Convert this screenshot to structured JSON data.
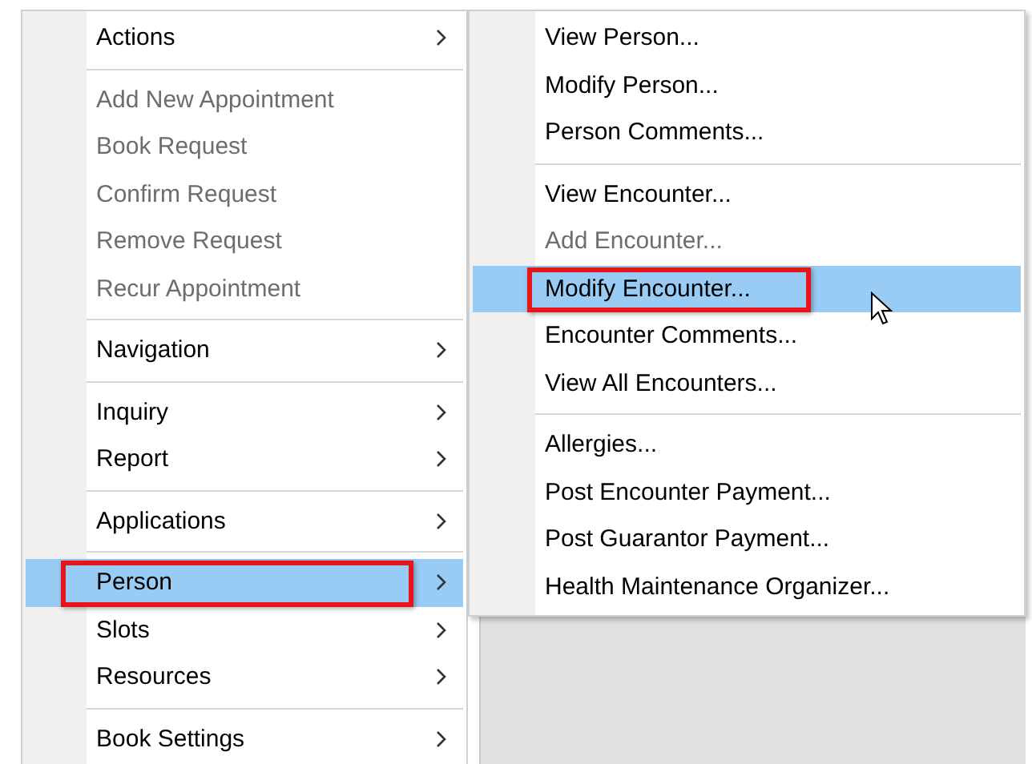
{
  "main_menu": {
    "groups": [
      {
        "items": [
          {
            "label": "Actions",
            "submenu": true,
            "disabled": false,
            "selected": false,
            "outlined": false
          }
        ]
      },
      {
        "items": [
          {
            "label": "Add New Appointment",
            "submenu": false,
            "disabled": true,
            "selected": false,
            "outlined": false
          },
          {
            "label": "Book Request",
            "submenu": false,
            "disabled": true,
            "selected": false,
            "outlined": false
          },
          {
            "label": "Confirm Request",
            "submenu": false,
            "disabled": true,
            "selected": false,
            "outlined": false
          },
          {
            "label": "Remove Request",
            "submenu": false,
            "disabled": true,
            "selected": false,
            "outlined": false
          },
          {
            "label": "Recur Appointment",
            "submenu": false,
            "disabled": true,
            "selected": false,
            "outlined": false
          }
        ]
      },
      {
        "items": [
          {
            "label": "Navigation",
            "submenu": true,
            "disabled": false,
            "selected": false,
            "outlined": false
          }
        ]
      },
      {
        "items": [
          {
            "label": "Inquiry",
            "submenu": true,
            "disabled": false,
            "selected": false,
            "outlined": false
          },
          {
            "label": "Report",
            "submenu": true,
            "disabled": false,
            "selected": false,
            "outlined": false
          }
        ]
      },
      {
        "items": [
          {
            "label": "Applications",
            "submenu": true,
            "disabled": false,
            "selected": false,
            "outlined": false
          }
        ]
      },
      {
        "items": [
          {
            "label": "Person",
            "submenu": true,
            "disabled": false,
            "selected": true,
            "outlined": true
          },
          {
            "label": "Slots",
            "submenu": true,
            "disabled": false,
            "selected": false,
            "outlined": false
          },
          {
            "label": "Resources",
            "submenu": true,
            "disabled": false,
            "selected": false,
            "outlined": false
          }
        ]
      },
      {
        "items": [
          {
            "label": "Book Settings",
            "submenu": true,
            "disabled": false,
            "selected": false,
            "outlined": false
          }
        ]
      }
    ]
  },
  "person_submenu": {
    "groups": [
      {
        "items": [
          {
            "label": "View Person...",
            "submenu": false,
            "disabled": false,
            "selected": false,
            "outlined": false
          },
          {
            "label": "Modify Person...",
            "submenu": false,
            "disabled": false,
            "selected": false,
            "outlined": false
          },
          {
            "label": "Person Comments...",
            "submenu": false,
            "disabled": false,
            "selected": false,
            "outlined": false
          }
        ]
      },
      {
        "items": [
          {
            "label": "View Encounter...",
            "submenu": false,
            "disabled": false,
            "selected": false,
            "outlined": false
          },
          {
            "label": "Add Encounter...",
            "submenu": false,
            "disabled": true,
            "selected": false,
            "outlined": false
          },
          {
            "label": "Modify Encounter...",
            "submenu": false,
            "disabled": false,
            "selected": true,
            "outlined": true
          },
          {
            "label": "Encounter Comments...",
            "submenu": false,
            "disabled": false,
            "selected": false,
            "outlined": false
          },
          {
            "label": "View All Encounters...",
            "submenu": false,
            "disabled": false,
            "selected": false,
            "outlined": false
          }
        ]
      },
      {
        "items": [
          {
            "label": "Allergies...",
            "submenu": false,
            "disabled": false,
            "selected": false,
            "outlined": false
          },
          {
            "label": "Post Encounter Payment...",
            "submenu": false,
            "disabled": false,
            "selected": false,
            "outlined": false
          },
          {
            "label": "Post Guarantor Payment...",
            "submenu": false,
            "disabled": false,
            "selected": false,
            "outlined": false
          },
          {
            "label": "Health Maintenance Organizer...",
            "submenu": false,
            "disabled": false,
            "selected": false,
            "outlined": false
          }
        ]
      }
    ]
  }
}
